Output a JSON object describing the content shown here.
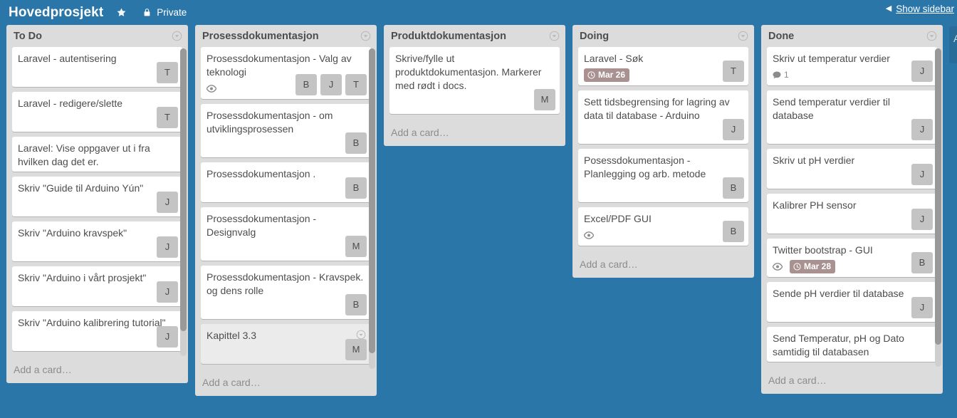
{
  "header": {
    "title": "Hovedprosjekt",
    "star_icon": "star-icon",
    "lock_icon": "lock-icon",
    "visibility": "Private",
    "sidebar_arrow": "◀",
    "sidebar_label": "Show sidebar"
  },
  "colors": {
    "board_background": "#2b76a8",
    "list_background": "#dcdcdc",
    "card_background": "#ffffff",
    "card_hover_background": "#ebebeb",
    "due_badge": "#a8918f",
    "avatar": "#c4c4c4",
    "text": "#4d4d4d",
    "muted_text": "#8c8c8c"
  },
  "add_list": {
    "label": "Add a list…"
  },
  "lists": [
    {
      "title": "To Do",
      "add_card": "Add a card…",
      "scroll": {
        "thumb_top_pct": 0,
        "thumb_height_pct": 92
      },
      "cards": [
        {
          "title": "Laravel - autentisering",
          "members": [
            "T"
          ],
          "badges": []
        },
        {
          "title": "Laravel - redigere/slette",
          "members": [
            "T"
          ],
          "badges": []
        },
        {
          "title": "Laravel: Vise oppgaver ut i fra hvilken dag det er.",
          "members": [],
          "badges": []
        },
        {
          "title": "Skriv \"Guide til Arduino Yún\"",
          "members": [
            "J"
          ],
          "badges": []
        },
        {
          "title": "Skriv \"Arduino kravspek\"",
          "members": [
            "J"
          ],
          "badges": []
        },
        {
          "title": "Skriv \"Arduino i vårt prosjekt\"",
          "members": [
            "J"
          ],
          "badges": []
        },
        {
          "title": "Skriv \"Arduino kalibrering tutorial\"",
          "members": [
            "J"
          ],
          "badges": []
        }
      ]
    },
    {
      "title": "Prosessdokumentasjon",
      "add_card": "Add a card…",
      "scroll": {
        "thumb_top_pct": 0,
        "thumb_height_pct": 95
      },
      "cards": [
        {
          "title": "Prosessdokumentasjon - Valg av teknologi",
          "members": [
            "B",
            "J",
            "T"
          ],
          "badges": [
            {
              "type": "watch",
              "icon": "eye-icon",
              "text": ""
            }
          ]
        },
        {
          "title": "Prosessdokumentasjon - om utviklingsprosessen",
          "members": [
            "B"
          ],
          "badges": []
        },
        {
          "title": "Prosessdokumentasjon .",
          "members": [
            "B"
          ],
          "badges": []
        },
        {
          "title": "Prosessdokumentasjon - Designvalg",
          "members": [
            "M"
          ],
          "badges": []
        },
        {
          "title": "Prosessdokumentasjon - Kravspek. og dens rolle",
          "members": [
            "B"
          ],
          "badges": []
        },
        {
          "title": "Kapittel 3.3",
          "members": [
            "M"
          ],
          "badges": [],
          "hovered": true,
          "edit_icon": "pencil-dropdown-icon"
        }
      ]
    },
    {
      "title": "Produktdokumentasjon",
      "add_card": "Add a card…",
      "scroll": null,
      "cards": [
        {
          "title": "Skrive/fylle ut produktdokumentasjon. Markerer med rødt i docs.",
          "members": [
            "M"
          ],
          "badges": []
        }
      ]
    },
    {
      "title": "Doing",
      "add_card": "Add a card…",
      "scroll": null,
      "cards": [
        {
          "title": "Laravel - Søk",
          "members": [
            "T"
          ],
          "badges": [
            {
              "type": "due",
              "icon": "clock-icon",
              "text": "Mar 26"
            }
          ]
        },
        {
          "title": "Sett tidsbegrensing for lagring av data til database - Arduino",
          "members": [
            "J"
          ],
          "badges": []
        },
        {
          "title": "Posessdokumentasjon - Planlegging og arb. metode",
          "members": [
            "B"
          ],
          "badges": []
        },
        {
          "title": "Excel/PDF GUI",
          "members": [
            "B"
          ],
          "badges": [
            {
              "type": "watch",
              "icon": "eye-icon",
              "text": ""
            }
          ]
        }
      ]
    },
    {
      "title": "Done",
      "add_card": "Add a card…",
      "scroll": {
        "thumb_top_pct": 0,
        "thumb_height_pct": 93
      },
      "cards": [
        {
          "title": "Skriv ut temperatur verdier",
          "members": [
            "J"
          ],
          "badges": [
            {
              "type": "comments",
              "icon": "comment-icon",
              "text": "1"
            }
          ]
        },
        {
          "title": "Send temperatur verdier til database",
          "members": [
            "J"
          ],
          "badges": []
        },
        {
          "title": "Skriv ut pH verdier",
          "members": [
            "J"
          ],
          "badges": []
        },
        {
          "title": "Kalibrer PH sensor",
          "members": [
            "J"
          ],
          "badges": []
        },
        {
          "title": "Twitter bootstrap - GUI",
          "members": [
            "B"
          ],
          "badges": [
            {
              "type": "watch",
              "icon": "eye-icon",
              "text": ""
            },
            {
              "type": "due",
              "icon": "clock-icon",
              "text": "Mar 28"
            }
          ]
        },
        {
          "title": "Sende pH verdier til database",
          "members": [
            "J"
          ],
          "badges": []
        },
        {
          "title": "Send Temperatur, pH og Dato samtidig til databasen",
          "members": [],
          "badges": []
        }
      ]
    }
  ]
}
